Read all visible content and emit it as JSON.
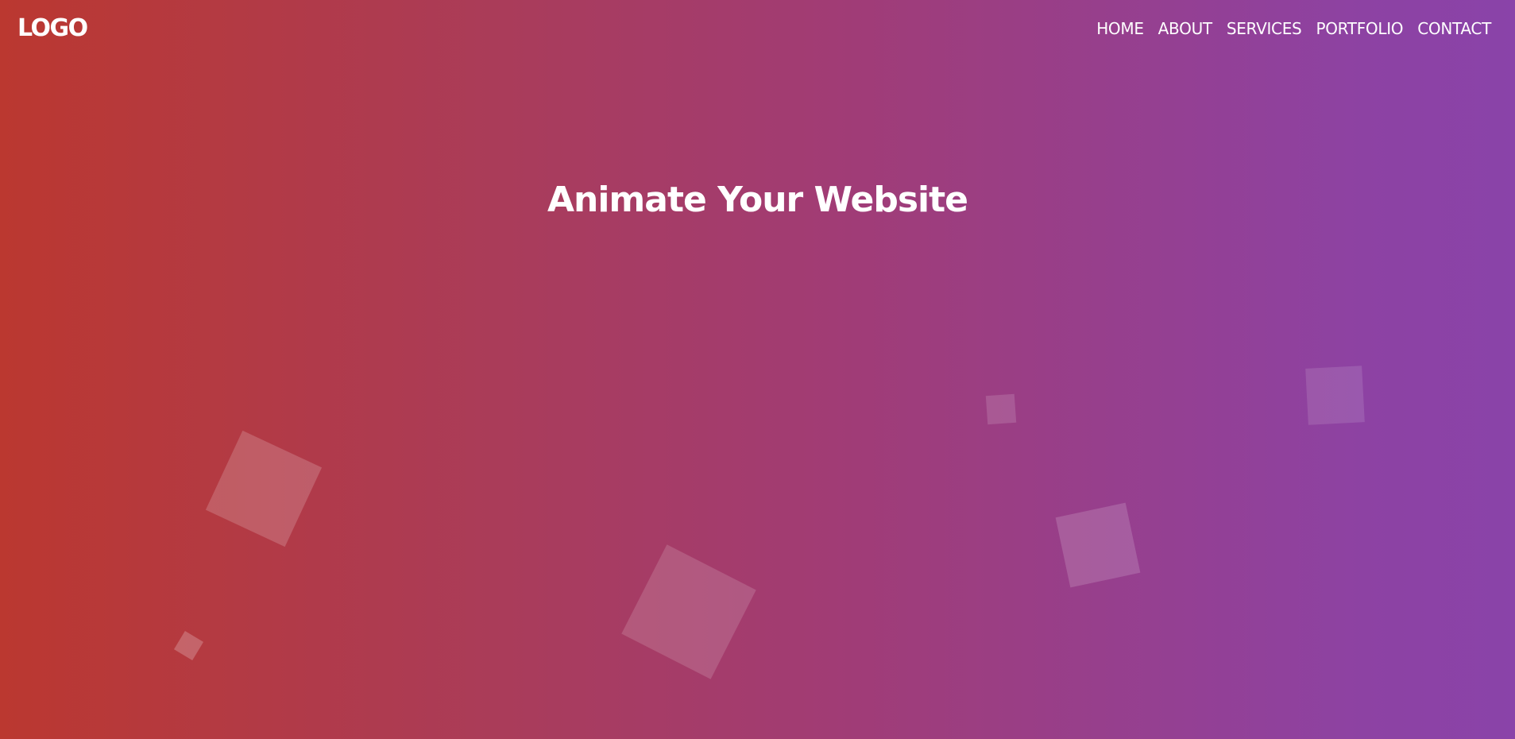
{
  "header": {
    "logo": "LOGO",
    "nav": [
      {
        "label": "HOME"
      },
      {
        "label": "ABOUT"
      },
      {
        "label": "SERVICES"
      },
      {
        "label": "PORTFOLIO"
      },
      {
        "label": "CONTACT"
      }
    ]
  },
  "hero": {
    "title": "Animate Your Website"
  },
  "colors": {
    "gradient_start": "#bb3830",
    "gradient_end": "#8a43a9",
    "text": "#ffffff"
  }
}
